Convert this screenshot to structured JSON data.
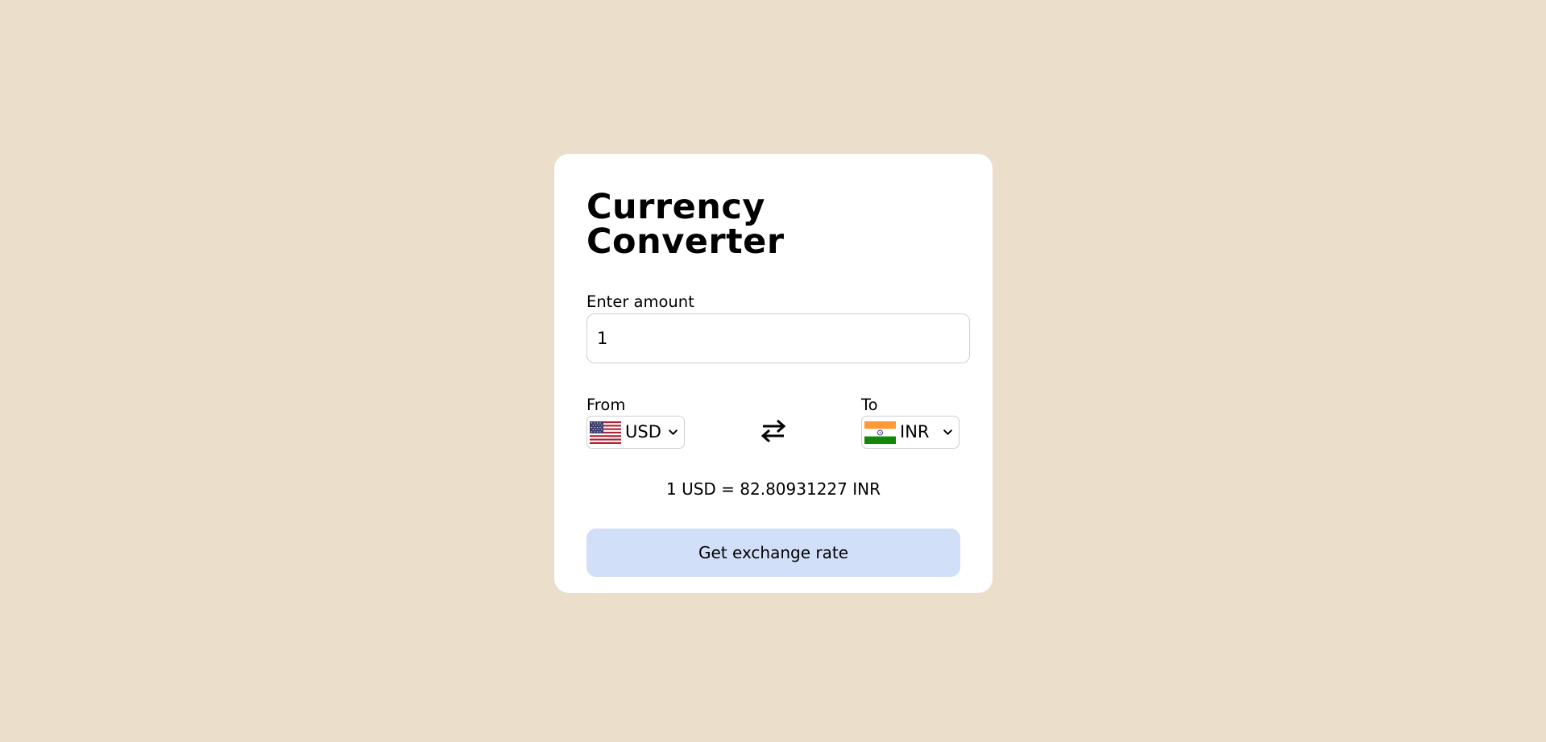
{
  "converter": {
    "title": "Currency Converter",
    "amount_label": "Enter amount",
    "amount_value": "1",
    "from_label": "From",
    "from_currency": "USD",
    "from_flag_icon": "us-flag-icon",
    "to_label": "To",
    "to_currency": "INR",
    "to_flag_icon": "india-flag-icon",
    "swap_icon": "swap-arrows-icon",
    "result_text": "1 USD = 82.80931227 INR",
    "button_label": "Get exchange rate"
  },
  "colors": {
    "page_background": "#ebdfcb",
    "card_background": "#ffffff",
    "button_background": "#d1dff8"
  }
}
